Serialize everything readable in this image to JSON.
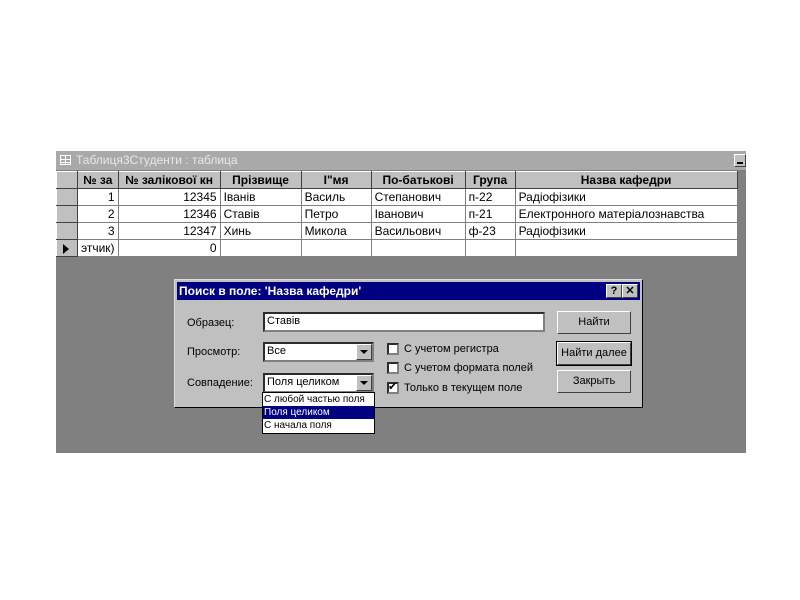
{
  "window": {
    "title": "Таблиця3Студенти : таблица"
  },
  "table": {
    "columns": [
      "№ за",
      "№ залікової кн",
      "Прізвище",
      "І\"мя",
      "По-батькові",
      "Група",
      "Назва кафедри"
    ],
    "rows": [
      [
        "1",
        "12345",
        "Іванів",
        "Василь",
        "Степанович",
        "п-22",
        "Радіофізики"
      ],
      [
        "2",
        "12346",
        "Ставів",
        "Петро",
        "Іванович",
        "п-21",
        "Електронного матеріалознавства"
      ],
      [
        "3",
        "12347",
        "Хинь",
        "Микола",
        "Васильович",
        "ф-23",
        "Радіофізики"
      ]
    ],
    "new_row": [
      "этчик)",
      "0",
      "",
      "",
      "",
      "",
      ""
    ]
  },
  "dialog": {
    "title": "Поиск в поле: 'Назва кафедри'",
    "help_btn": "?",
    "close_btn": "✕",
    "sample_label": "Образец:",
    "sample_value": "Ставів",
    "view_label": "Просмотр:",
    "view_value": "Все",
    "match_label": "Совпадение:",
    "match_value": "Поля целиком",
    "match_options": [
      "С любой частью поля",
      "Поля целиком",
      "С начала поля"
    ],
    "case_label": "С учетом регистра",
    "case_checked": false,
    "format_label": "С учетом формата полей",
    "format_checked": false,
    "current_field_label": "Только в текущем поле",
    "current_field_checked": true,
    "find_btn": "Найти",
    "find_next_btn": "Найти далее",
    "close_button": "Закрыть"
  }
}
